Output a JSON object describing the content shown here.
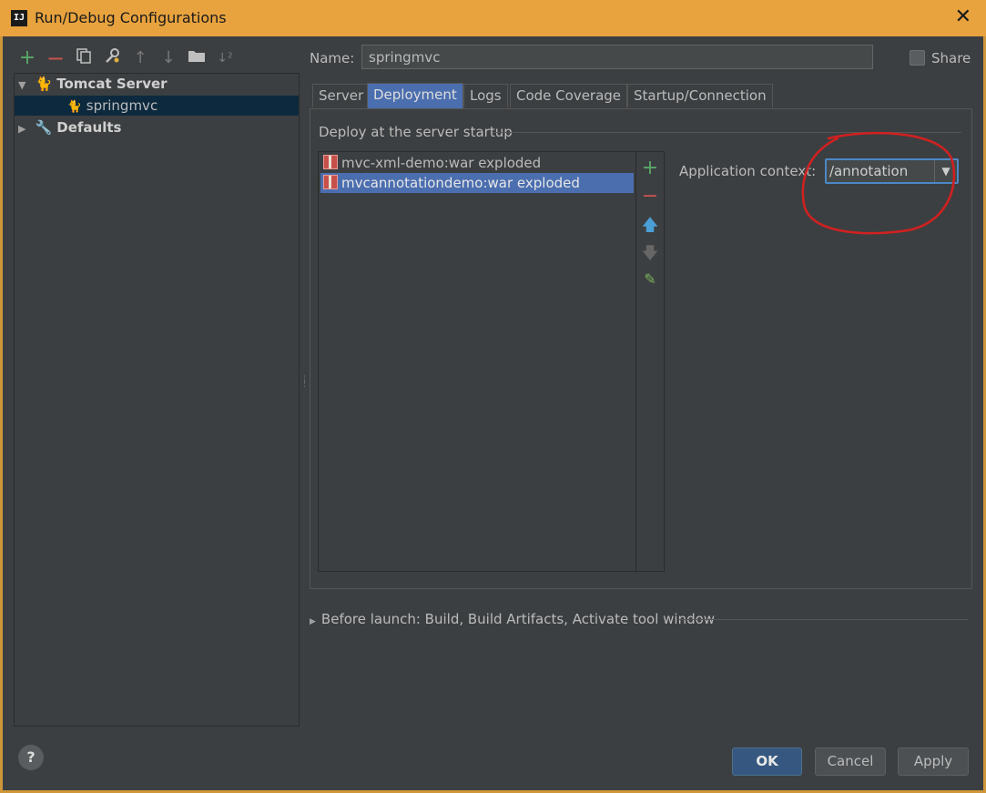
{
  "window": {
    "app_icon": "IJ",
    "title": "Run/Debug Configurations",
    "close": "✕"
  },
  "toolbar": {
    "icons": [
      "add-icon",
      "remove-icon",
      "copy-icon",
      "settings-icon",
      "move-up-icon",
      "move-down-icon",
      "folder-icon",
      "sort-icon"
    ]
  },
  "tree": {
    "group": "Tomcat Server",
    "child": "springmvc",
    "defaults": "Defaults"
  },
  "config": {
    "name_label": "Name:",
    "name_value": "springmvc",
    "share_label": "Share",
    "share_checked": false
  },
  "tabs": [
    "Server",
    "Deployment",
    "Logs",
    "Code Coverage",
    "Startup/Connection"
  ],
  "active_tab": "Deployment",
  "deployment": {
    "group_title": "Deploy at the server startup",
    "artifacts": [
      "mvc-xml-demo:war exploded",
      "mvcannotationdemo:war exploded"
    ],
    "selected_artifact": "mvcannotationdemo:war exploded",
    "context_label": "Application context:",
    "context_value": "/annotation",
    "annotation_color": "#d32020"
  },
  "before_launch": "Before launch: Build, Build Artifacts, Activate tool window",
  "buttons": {
    "help": "?",
    "ok": "OK",
    "cancel": "Cancel",
    "apply": "Apply"
  }
}
